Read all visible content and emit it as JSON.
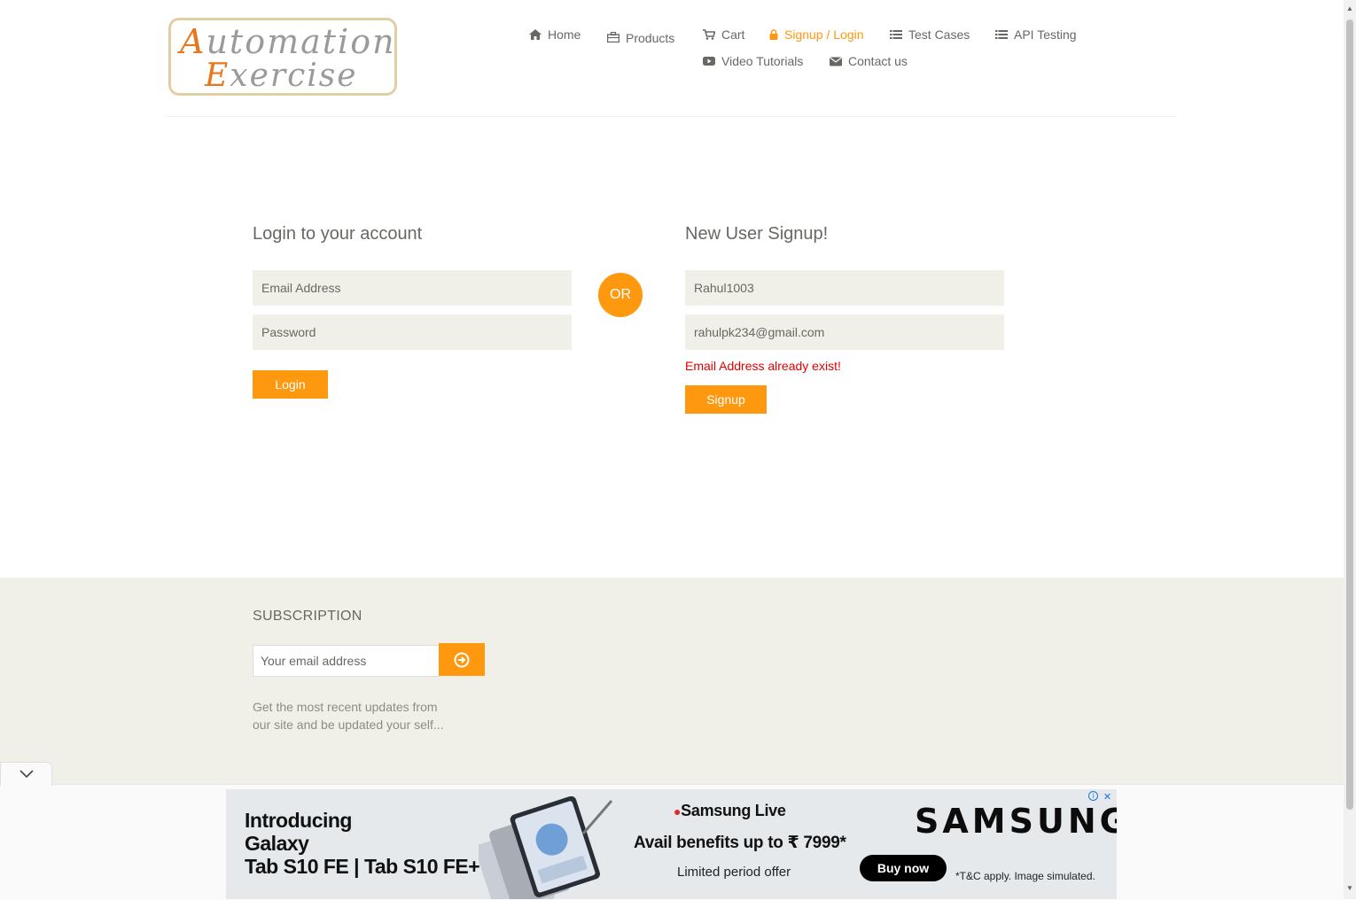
{
  "logo": {
    "line1_cap": "A",
    "line1_rest": "utomation",
    "line2_cap": "E",
    "line2_rest": "xercise"
  },
  "nav": {
    "home": "Home",
    "products": "Products",
    "cart": "Cart",
    "signup_login": "Signup / Login",
    "test_cases": "Test Cases",
    "api_testing": "API Testing",
    "video_tutorials": "Video Tutorials",
    "contact_us": "Contact us"
  },
  "login": {
    "title": "Login to your account",
    "email_placeholder": "Email Address",
    "password_placeholder": "Password",
    "button": "Login"
  },
  "or_label": "OR",
  "signup": {
    "title": "New User Signup!",
    "name_value": "Rahul1003",
    "email_value": "rahulpk234@gmail.com",
    "error": "Email Address already exist!",
    "button": "Signup"
  },
  "footer": {
    "subscription_title": "SUBSCRIPTION",
    "email_placeholder": "Your email address",
    "description": "Get the most recent updates from our site and be updated your self..."
  },
  "ad": {
    "intro_line1": "Introducing",
    "intro_line2": "Galaxy",
    "intro_line3": "Tab S10 FE | Tab S10 FE+",
    "live": "Samsung Live",
    "benefit": "Avail benefits up to ₹ 7999*",
    "limited": "Limited period offer",
    "brand": "SAMSUNG",
    "buy": "Buy now",
    "terms": "*T&C apply. Image simulated."
  },
  "colors": {
    "accent": "#fe980f",
    "input_bg": "#f0f0e9",
    "error": "#e00000",
    "text": "#696763"
  }
}
